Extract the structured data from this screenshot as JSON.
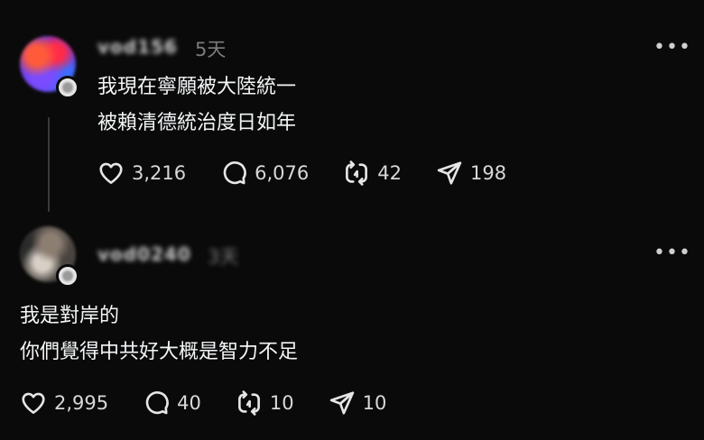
{
  "posts": [
    {
      "username": "vod156",
      "time": "5天",
      "lines": [
        "我現在寧願被大陸統一",
        "被賴清德統治度日如年"
      ],
      "likes": "3,216",
      "comments": "6,076",
      "reposts": "42",
      "shares": "198"
    },
    {
      "username": "vod0240",
      "time": "3天",
      "lines": [
        "我是對岸的",
        "你們覺得中共好大概是智力不足"
      ],
      "likes": "2,995",
      "comments": "40",
      "reposts": "10",
      "shares": "10"
    }
  ],
  "more_label": "•••",
  "icons": {
    "like": "heart-icon",
    "comment": "comment-bubble-icon",
    "repost": "repost-icon",
    "share": "send-icon"
  }
}
